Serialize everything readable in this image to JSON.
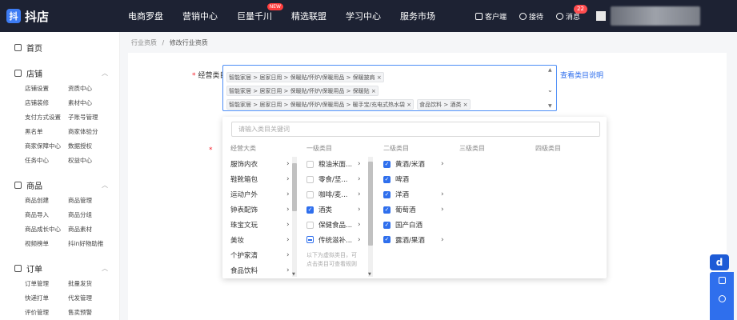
{
  "brand": {
    "logo_char": "抖",
    "name": "抖店"
  },
  "topnav": [
    {
      "label": "电商罗盘"
    },
    {
      "label": "营销中心"
    },
    {
      "label": "巨量千川",
      "badge": "NEW"
    },
    {
      "label": "精选联盟"
    },
    {
      "label": "学习中心"
    },
    {
      "label": "服务市场"
    }
  ],
  "top_right": {
    "client": "客户端",
    "reception": "接待",
    "messages": "消息",
    "message_count": "22"
  },
  "sidebar": {
    "home": "首页",
    "sections": [
      {
        "title": "店铺",
        "links": [
          "店铺设置",
          "资质中心",
          "店铺装修",
          "素材中心",
          "支付方式设置",
          "子账号管理",
          "黑名单",
          "商家体验分",
          "商家保障中心",
          "数据授权",
          "任务中心",
          "权益中心"
        ]
      },
      {
        "title": "商品",
        "links": [
          "商品创建",
          "商品管理",
          "商品导入",
          "商品分组",
          "商品成长中心",
          "商品素材",
          "视频榜单",
          "抖in好物助推"
        ]
      },
      {
        "title": "订单",
        "links": [
          "订单管理",
          "批量发货",
          "快递打单",
          "代发管理",
          "评价管理",
          "售卖预警"
        ]
      }
    ]
  },
  "breadcrumb": {
    "parent": "行业资质",
    "separator": "/",
    "current": "修改行业资质"
  },
  "form": {
    "category_label": "经营类目",
    "required_mark": "*",
    "help_link": "查看类目说明",
    "selected_tags": [
      [
        "智能家居 > 居家日用 > 保暖贴/怀炉/保暖用品 > 保暖披肩 ×"
      ],
      [
        "智能家居 > 居家日用 > 保暖贴/怀炉/保暖用品 > 保暖贴 ×"
      ],
      [
        "智能家居 > 居家日用 > 保暖贴/怀炉/保暖用品 > 暖手宝/充电式热水袋 ×",
        "食品饮料 > 酒类 ×"
      ]
    ]
  },
  "dropdown": {
    "search_placeholder": "请输入类目关键词",
    "column_headers": [
      "经营大类",
      "一级类目",
      "二级类目",
      "三级类目",
      "四级类目"
    ],
    "col0": [
      "服饰内衣",
      "鞋靴箱包",
      "运动户外",
      "钟表配饰",
      "珠宝文玩",
      "美妆",
      "个护家清",
      "食品饮料"
    ],
    "col1": [
      {
        "label": "粮油米面...",
        "state": "unchecked"
      },
      {
        "label": "零食/坚...",
        "state": "unchecked"
      },
      {
        "label": "咖啡/麦...",
        "state": "unchecked"
      },
      {
        "label": "酒类",
        "state": "checked"
      },
      {
        "label": "保健食品...",
        "state": "unchecked"
      },
      {
        "label": "传统滋补...",
        "state": "indeterminate"
      }
    ],
    "col1_note": "以下为虚拟类目，可\n点击类目可查看规则",
    "col2": [
      {
        "label": "黄酒/米酒",
        "state": "checked",
        "has_children": true
      },
      {
        "label": "啤酒",
        "state": "checked",
        "has_children": false
      },
      {
        "label": "洋酒",
        "state": "checked",
        "has_children": true
      },
      {
        "label": "葡萄酒",
        "state": "checked",
        "has_children": true
      },
      {
        "label": "国产白酒",
        "state": "checked",
        "has_children": false
      },
      {
        "label": "露酒/果酒",
        "state": "checked",
        "has_children": true
      }
    ]
  },
  "floating": {
    "logo_char": "d"
  },
  "colors": {
    "topbar": "#1d2233",
    "accent": "#2f6fed",
    "badge": "#ff4d4f"
  }
}
